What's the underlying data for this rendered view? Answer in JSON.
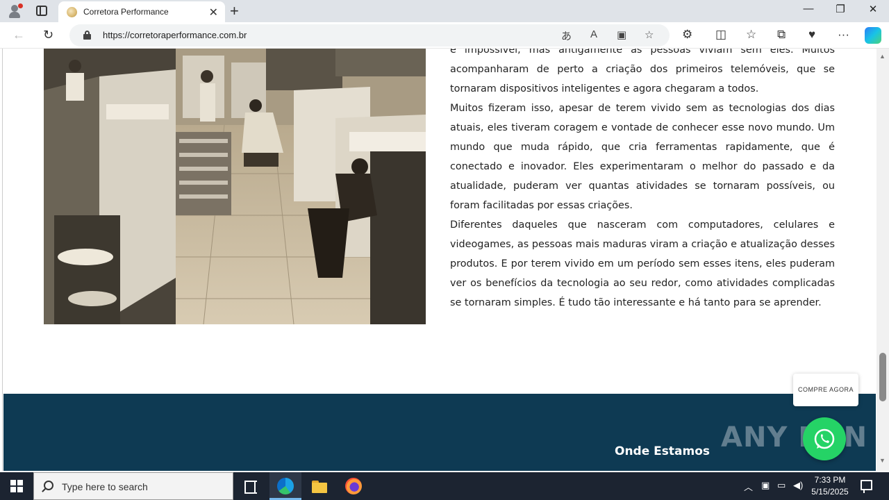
{
  "browser": {
    "tab_title": "Corretora Performance",
    "url": "https://corretoraperformance.com.br",
    "new_tab_symbol": "+",
    "tab_close_symbol": "✕",
    "window_controls": {
      "minimize": "—",
      "restore": "❐",
      "close": "✕"
    },
    "nav": {
      "back": "←",
      "reload": "↻"
    },
    "address_icons": {
      "translate": "あ",
      "read_aloud": "A",
      "immersive": "▣",
      "favorite": "☆"
    },
    "toolbar_icons": {
      "extensions": "⚙",
      "split": "◫",
      "favorites": "☆",
      "collections": "⧉",
      "performance": "♥",
      "more": "···"
    }
  },
  "article": {
    "paragraphs": [
      "é impossível, mas antigamente as pessoas viviam sem eles. Muitos acompanharam de perto a criação dos primeiros telemóveis, que se tornaram dispositivos inteligentes e agora chegaram a todos.",
      "Muitos fizeram isso, apesar de terem vivido sem as tecnologias dos dias atuais, eles tiveram coragem e vontade de conhecer esse novo mundo. Um mundo que muda rápido, que cria ferramentas rapidamente, que é conectado e inovador. Eles experimentaram o melhor do passado e da atualidade, puderam ver quantas atividades se tornaram possíveis, ou foram facilitadas por essas criações.",
      "Diferentes daqueles que nasceram com computadores, celulares e videogames, as pessoas mais maduras viram a criação e atualização desses produtos. E por terem vivido em um período sem esses itens, eles puderam ver os benefícios da tecnologia ao seu redor, como atividades complicadas se tornaram simples. É tudo tão interessante e há tanto para se aprender."
    ]
  },
  "footer": {
    "heading": "Onde Estamos",
    "bg_color": "#0e3a53"
  },
  "floating": {
    "compre_label": "COMPRE AGORA",
    "whatsapp_color": "#25d366",
    "watermark": "ANY RUN"
  },
  "taskbar": {
    "search_placeholder": "Type here to search",
    "time": "7:33 PM",
    "date": "5/15/2025"
  }
}
